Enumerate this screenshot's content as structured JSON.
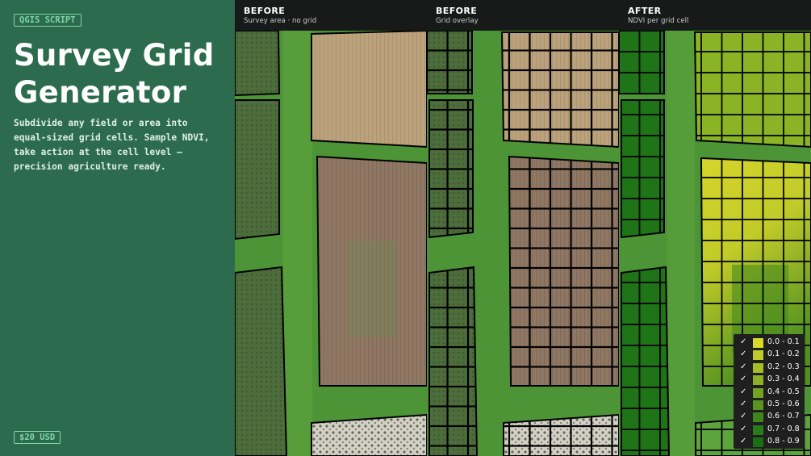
{
  "promo": {
    "badge": "QGIS SCRIPT",
    "title_line1": "Survey Grid",
    "title_line2": "Generator",
    "description": "Subdivide any field or area into equal-sized grid cells. Sample NDVI, take action at the cell level — precision agriculture ready.",
    "price": "$20 USD"
  },
  "panels": [
    {
      "label": "BEFORE",
      "sublabel": "Survey area · no grid"
    },
    {
      "label": "BEFORE",
      "sublabel": "Grid overlay"
    },
    {
      "label": "AFTER",
      "sublabel": "NDVI per grid cell"
    }
  ],
  "legend": {
    "check_mark": "✓",
    "items": [
      {
        "label": "0.0 - 0.1",
        "color": "#d8da2a"
      },
      {
        "label": "0.1 - 0.2",
        "color": "#bfcb27"
      },
      {
        "label": "0.2 - 0.3",
        "color": "#a7bd26"
      },
      {
        "label": "0.3 - 0.4",
        "color": "#8db025"
      },
      {
        "label": "0.4 - 0.5",
        "color": "#73a224"
      },
      {
        "label": "0.5 - 0.6",
        "color": "#589421"
      },
      {
        "label": "0.6 - 0.7",
        "color": "#3f861e"
      },
      {
        "label": "0.7 - 0.8",
        "color": "#2a7b1b"
      },
      {
        "label": "0.8 - 0.9",
        "color": "#1b6f17"
      }
    ]
  }
}
